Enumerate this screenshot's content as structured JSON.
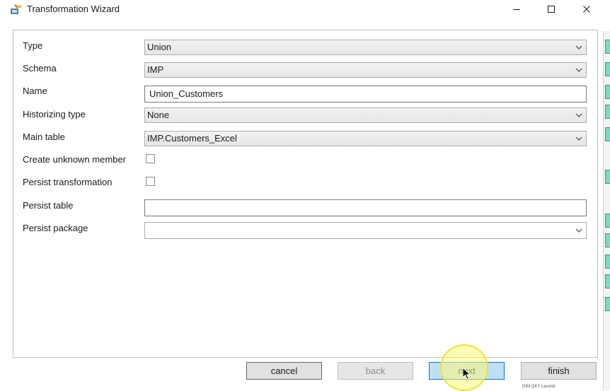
{
  "window": {
    "title": "Transformation Wizard"
  },
  "form": {
    "type": {
      "label": "Type",
      "value": "Union"
    },
    "schema": {
      "label": "Schema",
      "value": "IMP"
    },
    "name": {
      "label": "Name",
      "value": "Union_Customers"
    },
    "historizing_type": {
      "label": "Historizing type",
      "value": "None"
    },
    "main_table": {
      "label": "Main table",
      "value": "IMP.Customers_Excel"
    },
    "create_unknown_member": {
      "label": "Create unknown member",
      "checked": false
    },
    "persist_transformation": {
      "label": "Persist transformation",
      "checked": false
    },
    "persist_table": {
      "label": "Persist table",
      "value": ""
    },
    "persist_package": {
      "label": "Persist package",
      "value": ""
    }
  },
  "buttons": {
    "cancel": "cancel",
    "back": "back",
    "next": "next",
    "finish": "finish"
  },
  "icons": {
    "app": "wizard-app-icon",
    "minimize": "minimize-icon",
    "maximize": "maximize-icon",
    "close": "close-icon",
    "dropdown": "chevron-down-icon",
    "cursor": "mouse-cursor-icon"
  },
  "colors": {
    "next_button_bg": "#bee0f7",
    "next_button_border": "#0078d7",
    "cursor_highlight": "#fff878"
  },
  "background": {
    "partial_text": "DIM QKY Lacorid"
  }
}
